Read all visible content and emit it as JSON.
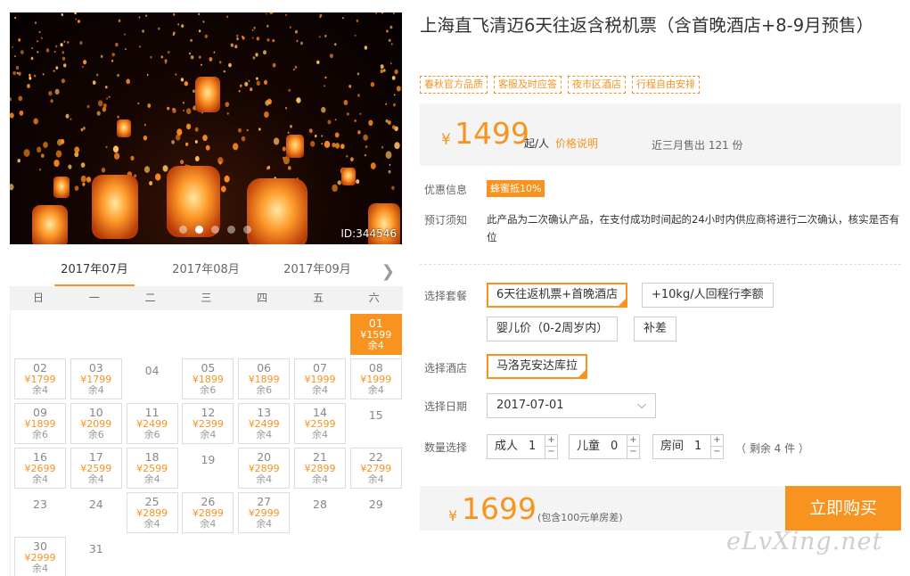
{
  "hero": {
    "image_label": "sky lanterns photo",
    "id_label": "ID:344546",
    "dot_count": 5,
    "active_dot": 1
  },
  "title": "上海直飞清迈6天往返含税机票（含首晚酒店+8-9月预售）",
  "tags": [
    "春秋官方品质",
    "客服及时应答",
    "夜市区酒店",
    "行程自由安排"
  ],
  "price": {
    "currency": "¥",
    "amount": "1499",
    "unit": "起/人",
    "explain_link": "价格说明",
    "sold_text": "近三月售出 121 份"
  },
  "info": {
    "discount_label": "优惠信息",
    "discount_badge": "蜂蜜抵10%",
    "notice_label": "预订须知",
    "notice_text": "此产品为二次确认产品，在支付成功时间起的24小时内供应商将进行二次确认，核实是否有位"
  },
  "options": {
    "package_label": "选择套餐",
    "packages": [
      {
        "label": "6天往返机票+首晚酒店",
        "selected": true
      },
      {
        "label": "+10kg/人回程行李额",
        "selected": false
      },
      {
        "label": "婴儿价（0-2周岁内）",
        "selected": false
      },
      {
        "label": "补差",
        "selected": false
      }
    ],
    "hotel_label": "选择酒店",
    "hotel": "马洛克安达库拉",
    "date_label": "选择日期",
    "date_value": "2017-07-01",
    "qty_label": "数量选择",
    "adult_label": "成人",
    "adult_value": "1",
    "child_label": "儿童",
    "child_value": "0",
    "room_label": "房间",
    "room_value": "1",
    "remaining": "（ 剩余 4 件 ）"
  },
  "bottom": {
    "currency": "¥",
    "total": "1699",
    "note": "(包含100元单房差)",
    "buy_label": "立即购买"
  },
  "watermark": "eLvXing.net",
  "calendar": {
    "months": [
      "2017年07月",
      "2017年08月",
      "2017年09月"
    ],
    "active_month": 0,
    "weekdays": [
      "日",
      "一",
      "二",
      "三",
      "四",
      "五",
      "六"
    ],
    "days": [
      {
        "d": "01",
        "p": "¥1599",
        "r": "余4",
        "sel": true
      },
      {
        "d": "02",
        "p": "¥1799",
        "r": "余4"
      },
      {
        "d": "03",
        "p": "¥1799",
        "r": "余4"
      },
      {
        "d": "04"
      },
      {
        "d": "05",
        "p": "¥1899",
        "r": "余6"
      },
      {
        "d": "06",
        "p": "¥1899",
        "r": "余6"
      },
      {
        "d": "07",
        "p": "¥1999",
        "r": "余4"
      },
      {
        "d": "08",
        "p": "¥1999",
        "r": "余4"
      },
      {
        "d": "09",
        "p": "¥1899",
        "r": "余6"
      },
      {
        "d": "10",
        "p": "¥2099",
        "r": "余6"
      },
      {
        "d": "11",
        "p": "¥2499",
        "r": "余6"
      },
      {
        "d": "12",
        "p": "¥2399",
        "r": "余4"
      },
      {
        "d": "13",
        "p": "¥2499",
        "r": "余4"
      },
      {
        "d": "14",
        "p": "¥2599",
        "r": "余4"
      },
      {
        "d": "15"
      },
      {
        "d": "16",
        "p": "¥2699",
        "r": "余4"
      },
      {
        "d": "17",
        "p": "¥2599",
        "r": "余4"
      },
      {
        "d": "18",
        "p": "¥2599",
        "r": "余4"
      },
      {
        "d": "19"
      },
      {
        "d": "20",
        "p": "¥2899",
        "r": "余4"
      },
      {
        "d": "21",
        "p": "¥2899",
        "r": "余4"
      },
      {
        "d": "22",
        "p": "¥2799",
        "r": "余4"
      },
      {
        "d": "23"
      },
      {
        "d": "24"
      },
      {
        "d": "25",
        "p": "¥2899",
        "r": "余4"
      },
      {
        "d": "26",
        "p": "¥2899",
        "r": "余4"
      },
      {
        "d": "27",
        "p": "¥2999",
        "r": "余4"
      },
      {
        "d": "28"
      },
      {
        "d": "29"
      },
      {
        "d": "30",
        "p": "¥2999",
        "r": "余4"
      },
      {
        "d": "31"
      }
    ],
    "first_weekday": 6
  }
}
